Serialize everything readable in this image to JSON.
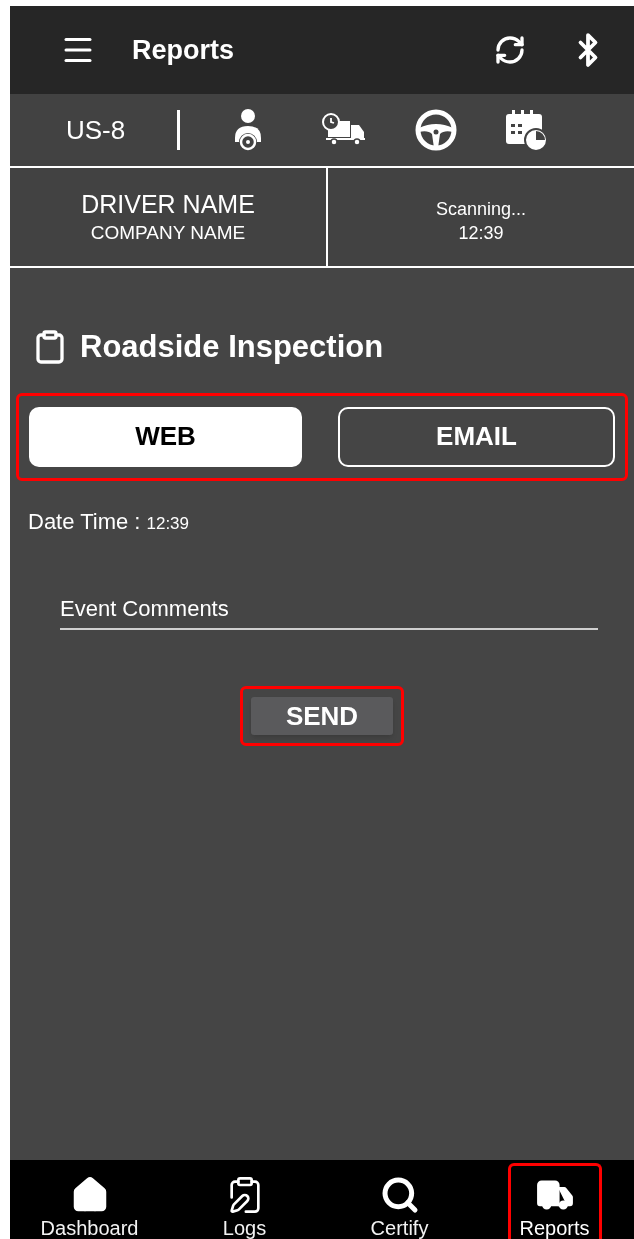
{
  "header": {
    "title": "Reports"
  },
  "status_bar": {
    "unit": "US-8"
  },
  "driver": {
    "name": "DRIVER NAME",
    "company": "COMPANY NAME",
    "status": "Scanning...",
    "time": "12:39"
  },
  "section": {
    "title": "Roadside Inspection"
  },
  "tabs_highlighted": true,
  "tabs": [
    {
      "label": "WEB",
      "selected": true
    },
    {
      "label": "EMAIL",
      "selected": false
    }
  ],
  "date_time": {
    "label": "Date Time :",
    "value": "12:39"
  },
  "comments": {
    "placeholder": "Event Comments"
  },
  "send": {
    "label": "SEND",
    "highlighted": true
  },
  "nav": [
    {
      "label": "Dashboard",
      "kind": "home",
      "selected": false,
      "highlighted": false
    },
    {
      "label": "Logs",
      "kind": "logs",
      "selected": false,
      "highlighted": false
    },
    {
      "label": "Certify",
      "kind": "certify",
      "selected": false,
      "highlighted": false
    },
    {
      "label": "Reports",
      "kind": "reports",
      "selected": true,
      "highlighted": true
    }
  ]
}
